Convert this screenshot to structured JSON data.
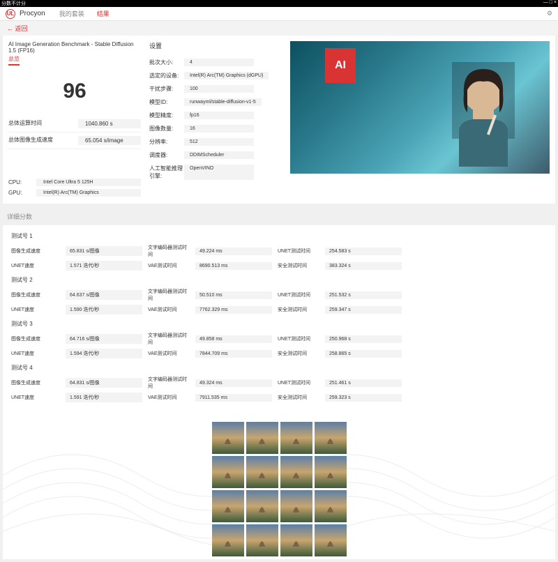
{
  "titlebar": {
    "left": "分数不计分"
  },
  "brand": "Procyon",
  "tabs": {
    "suite": "我的套装",
    "results": "结果"
  },
  "back": "← 返回",
  "benchmark": {
    "title": "AI Image Generation Benchmark - Stable Diffusion 1.5 (FP16)",
    "overview_tab": "总览",
    "score": "96",
    "total_time_label": "总体运算时间",
    "total_time": "1040.860 s",
    "gen_speed_label": "总体图像生成速度",
    "gen_speed": "65.054 s/image"
  },
  "hw": {
    "cpu_label": "CPU:",
    "cpu": "Intel Core Ultra 5 125H",
    "gpu_label": "GPU:",
    "gpu": "Intel(R) Arc(TM) Graphics"
  },
  "settings": {
    "header": "设置",
    "batch_size_label": "批次大小:",
    "batch_size": "4",
    "device_label": "选定的设备:",
    "device": "Intel(R) Arc(TM) Graphics (dGPU)",
    "steps_label": "干扰步骤:",
    "steps": "100",
    "model_id_label": "模型ID:",
    "model_id": "runwayml/stable-diffusion-v1-5",
    "precision_label": "模型精度:",
    "precision": "fp16",
    "images_label": "图像数量:",
    "images": "16",
    "resolution_label": "分辨率:",
    "resolution": "512",
    "scheduler_label": "调度器:",
    "scheduler": "DDIMScheduler",
    "engine_label": "人工智能推理引擎:",
    "engine": "OpenVINO"
  },
  "hero_ai": "AI",
  "details_header": "详细分数",
  "run_labels": {
    "img_speed": "图像生成速度",
    "unet_speed": "UNET速度",
    "text_enc": "文字编码器测试时间",
    "vae": "VAE测试时间",
    "unet_time": "UNET测试时间",
    "safety": "安全测试时间"
  },
  "runs": [
    {
      "title": "测试号 1",
      "img_speed": "65.831 s/图像",
      "unet_speed": "1.571 迭代/秒",
      "text_enc": "49.224 ms",
      "vae": "8690.513 ms",
      "unet_time": "254.583 s",
      "safety": "383.324 s"
    },
    {
      "title": "测试号 2",
      "img_speed": "64.637 s/图像",
      "unet_speed": "1.590 迭代/秒",
      "text_enc": "50.510 ms",
      "vae": "7762.329 ms",
      "unet_time": "251.532 s",
      "safety": "259.347 s"
    },
    {
      "title": "测试号 3",
      "img_speed": "64.716 s/图像",
      "unet_speed": "1.594 迭代/秒",
      "text_enc": "49.858 ms",
      "vae": "7844.709 ms",
      "unet_time": "250.968 s",
      "safety": "258.865 s"
    },
    {
      "title": "测试号 4",
      "img_speed": "64.831 s/图像",
      "unet_speed": "1.591 迭代/秒",
      "text_enc": "49.324 ms",
      "vae": "7911.535 ms",
      "unet_time": "251.461 s",
      "safety": "259.323 s"
    }
  ]
}
